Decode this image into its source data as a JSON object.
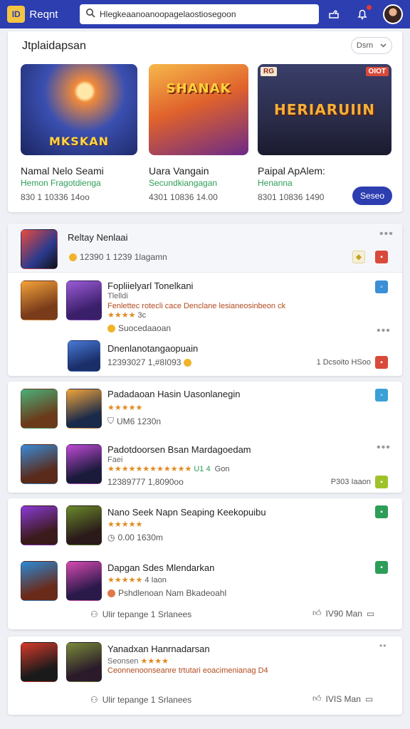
{
  "app": {
    "logo_text": "ID",
    "brand": "Reqnt",
    "search_value": "Hlegkeaanoanoopagelaostiosegoon"
  },
  "featured": {
    "title": "Jtplaidapsan",
    "sort_label": "Dsrn",
    "games": [
      {
        "art_text": "MKSKAN",
        "name": "Namal Nelo Seami",
        "genre": "Hemon Fragotdienga",
        "meta": "830 1 10336 14oo"
      },
      {
        "art_text": "SHANAK",
        "name": "Uara Vangain",
        "genre": "Secundkiangagan",
        "meta": "4301 10836 14.00"
      },
      {
        "art_text": "HERIARUIIN",
        "tag_left": "RG",
        "tag_right": "OIOT",
        "name": "Paipal ApAlem:",
        "genre": "Henanna",
        "meta": "8301 10836 1490"
      }
    ],
    "play_label": "Seseo"
  },
  "group1": {
    "head": {
      "title": "Reltay Nenlaai",
      "meta": "12390 1 1239 1lagamn"
    },
    "row1": {
      "title": "Fopliielyarl Tonelkani",
      "sub": "Tlelldi",
      "desc": "Fenlettec rotecli cace Denclane lesianeosinbeon ck",
      "rating_num": "3c",
      "meta": "Suocedaaoan"
    },
    "row2": {
      "title": "Dnenlanotangaopuain",
      "meta": "12393027 1,#8I093",
      "right": "1 Dcsoito HSoo"
    }
  },
  "group2": {
    "row1": {
      "title": "Padadaoan Hasin Uasonlanegin",
      "meta": "UM6 1230n"
    },
    "row2": {
      "title": "Padotdoorsen Bsan Mardagoedam",
      "sub": "Faei",
      "rating_num": "U1 4",
      "rating_tail": "Gon",
      "meta": "12389777 1,8090oo",
      "right": "P303 Iaaon"
    }
  },
  "group3": {
    "row1": {
      "title": "Nano Seek Napn Seaping Keekopuibu",
      "meta": "0.00 1630m"
    },
    "row2": {
      "title": "Dapgan Sdes Mlendarkan",
      "rating_num": "4 Iaon",
      "meta": "Pshdlenoan Nam Bkadeoahl"
    },
    "footer_left": "Ulir tepange 1 Srlanees",
    "footer_right": "IV90 Man"
  },
  "group4": {
    "row1": {
      "title": "Yanadxan Hanrnadarsan",
      "sub": "Seonsen",
      "desc": "Ceonnenoonseanre trtutari eoacimenianag D4"
    },
    "footer_left": "Ulir tepange 1 Srlanees",
    "footer_right": "IVIS Man"
  },
  "colors": {
    "brand": "#2d3eb0",
    "accent_red": "#d84a3a",
    "accent_green": "#2e9d58",
    "star": "#e08a1e"
  }
}
